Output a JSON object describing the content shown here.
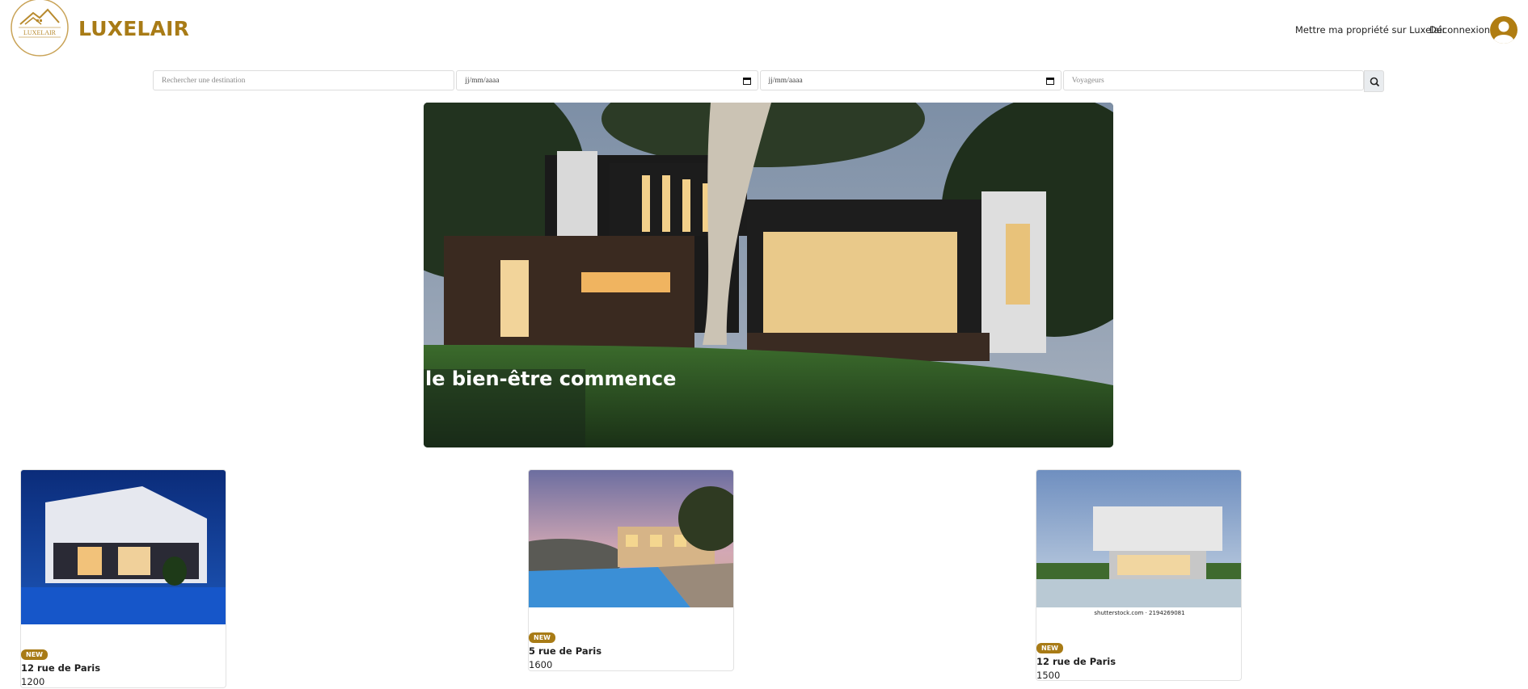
{
  "header": {
    "brand": "LUXELAIR",
    "logo_text": "LUXELAIR",
    "nav": {
      "host_label": "Mettre ma propriété sur Luxelair",
      "logout_label": "Déconnexion"
    },
    "avatar_icon": "user-circle-icon",
    "accent_color": "#a87b16"
  },
  "search": {
    "destination_placeholder": "Rechercher une destination",
    "checkin_value": "jj/mm/aaaa",
    "checkout_value": "jj/mm/aaaa",
    "guests_placeholder": "Voyageurs",
    "button_icon": "search-icon"
  },
  "hero": {
    "tagline": "le bien-être commence"
  },
  "listings": [
    {
      "badge": "NEW",
      "address": "12 rue de Paris",
      "price": "1200"
    },
    {
      "badge": "NEW",
      "address": "5 rue de Paris",
      "price": "1600"
    },
    {
      "badge": "NEW",
      "address": "12 rue de Paris",
      "price": "1500",
      "image_caption": "shutterstock.com · 2194269081"
    }
  ]
}
